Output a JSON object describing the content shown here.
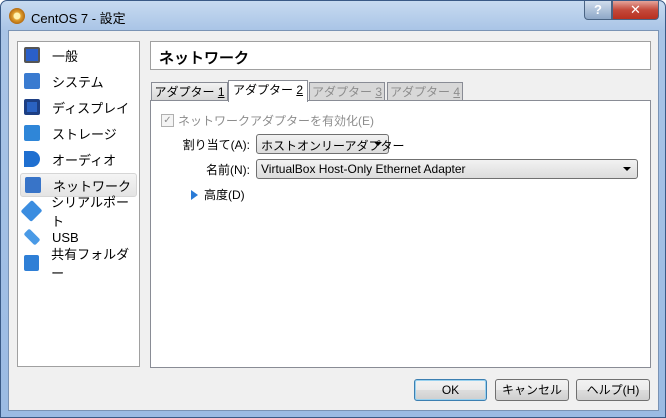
{
  "window": {
    "title": "CentOS 7 - 設定",
    "help": "?",
    "close": "✕"
  },
  "sidebar": {
    "items": [
      {
        "label": "一般",
        "color": "#2a5fc9"
      },
      {
        "label": "システム",
        "color": "#3a7bd0"
      },
      {
        "label": "ディスプレイ",
        "color": "#2a62c2"
      },
      {
        "label": "ストレージ",
        "color": "#2f86d8"
      },
      {
        "label": "オーディオ",
        "color": "#1f6fd0"
      },
      {
        "label": "ネットワーク",
        "color": "#3874c8"
      },
      {
        "label": "シリアルポート",
        "color": "#3b8de0"
      },
      {
        "label": "USB",
        "color": "#4a9ae6"
      },
      {
        "label": "共有フォルダー",
        "color": "#2f7fd6"
      }
    ],
    "selected": 5
  },
  "page": {
    "title": "ネットワーク"
  },
  "tabs": [
    {
      "label": "アダプター ",
      "key": "1"
    },
    {
      "label": "アダプター ",
      "key": "2"
    },
    {
      "label": "アダプター ",
      "key": "3"
    },
    {
      "label": "アダプター ",
      "key": "4"
    }
  ],
  "form": {
    "enable_label": "ネットワークアダプターを有効化(E)",
    "attached_label": "割り当て(A):",
    "attached_value": "ホストオンリーアダプター",
    "name_label": "名前(N):",
    "name_value": "VirtualBox Host-Only Ethernet Adapter",
    "advanced_label": "高度(D)"
  },
  "buttons": {
    "ok": "OK",
    "cancel": "キャンセル",
    "help": "ヘルプ(H)"
  }
}
